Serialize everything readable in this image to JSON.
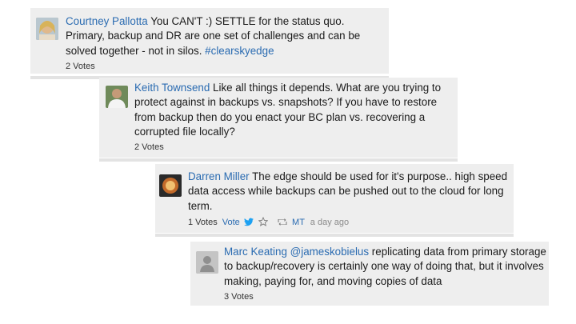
{
  "comments": [
    {
      "author": "Courtney Pallotta",
      "text": " You CAN'T :) SETTLE for the status quo. Primary, backup and DR are one set of challenges and can be solved together - not in silos. ",
      "hashtag": "#clearskyedge",
      "votes": "2 Votes",
      "avatar_icon": "user-photo-icon"
    },
    {
      "author": "Keith Townsend",
      "text": " Like all things it depends. What are you trying to protect against in backups vs. snapshots? If you have to restore from backup then do you enact your BC plan vs. recovering a corrupted file locally?",
      "votes": "2 Votes",
      "avatar_icon": "user-photo-icon"
    },
    {
      "author": "Darren Miller",
      "text": " The edge should be used for it's purpose.. high speed data access while backups can be pushed out to the cloud for long term.",
      "votes": "1 Votes",
      "vote_label": "Vote",
      "mt_label": "MT",
      "timestamp": "a day ago",
      "avatar_icon": "user-photo-icon"
    },
    {
      "author": "Marc Keating",
      "mention": " @jameskobielus",
      "text": " replicating data from primary storage to backup/recovery is certainly one way of doing that, but it involves making, paying for, and moving copies of data",
      "votes": "3 Votes",
      "avatar_icon": "default-user-icon"
    }
  ],
  "colors": {
    "link": "#2a6bb1",
    "card_bg": "#eeeeee",
    "divider": "#e3e3e3",
    "twitter": "#1da1f2"
  }
}
